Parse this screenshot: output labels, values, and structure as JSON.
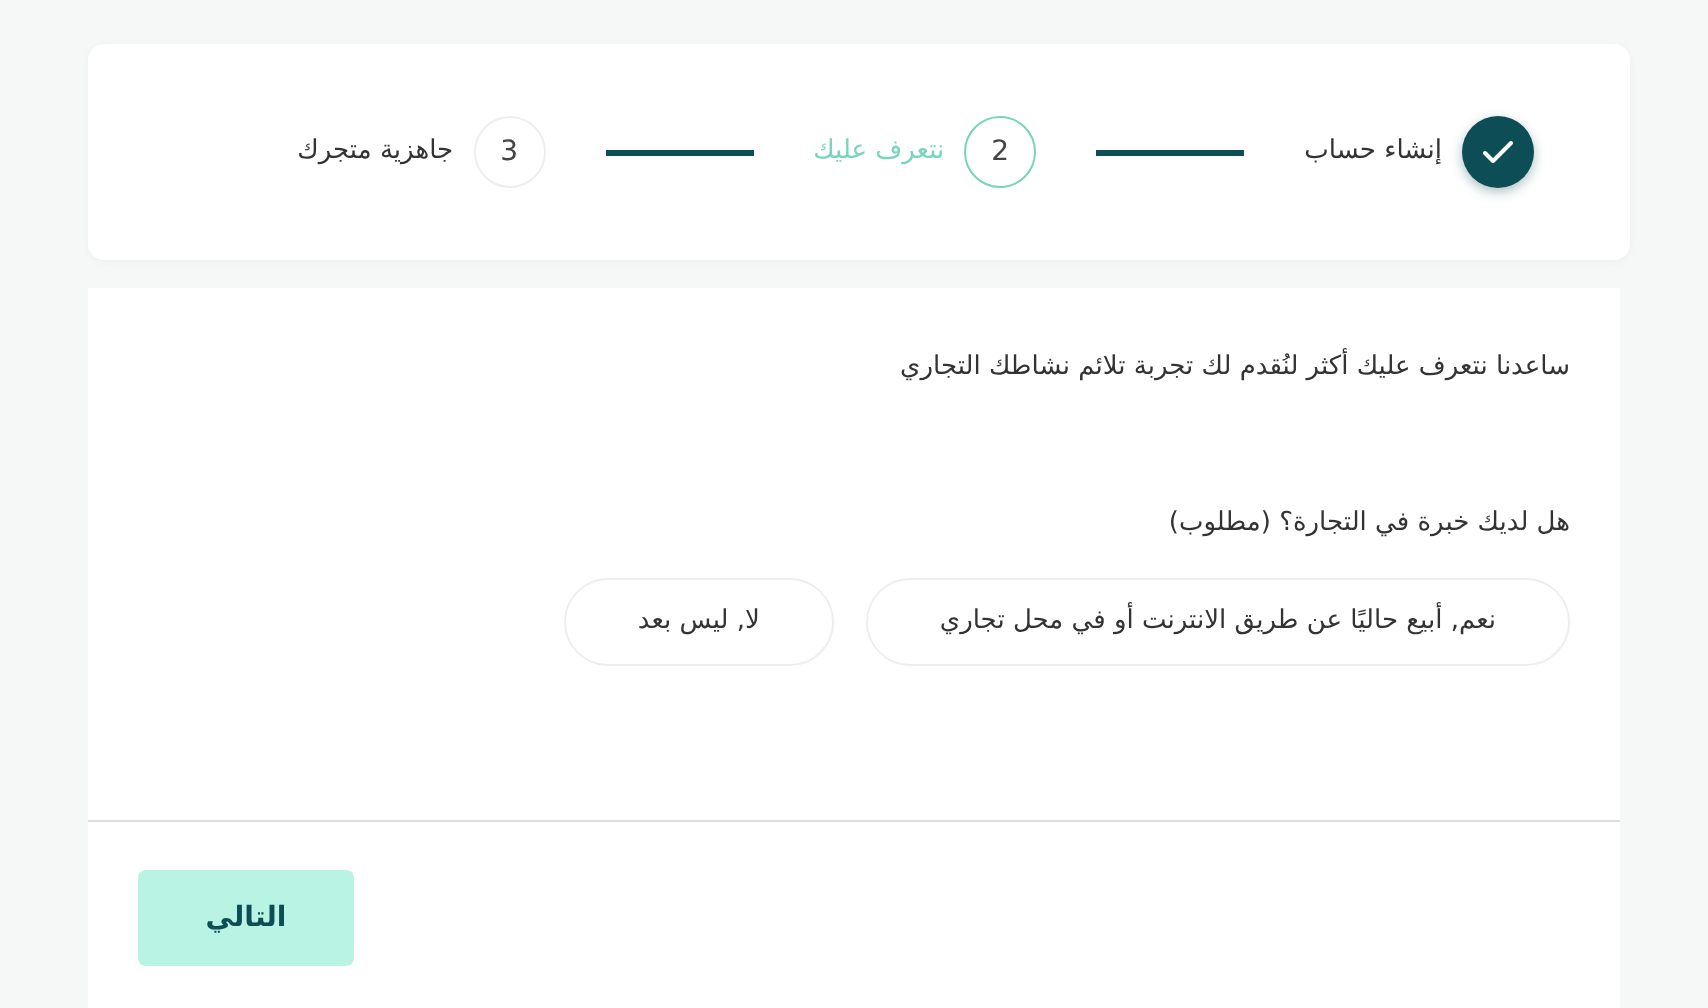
{
  "steps": [
    {
      "label": "إنشاء حساب",
      "done": true,
      "selected": false
    },
    {
      "number": "2",
      "label": "نتعرف عليك",
      "done": false,
      "selected": true
    },
    {
      "number": "3",
      "label": "جاهزية متجرك",
      "done": false,
      "selected": false
    }
  ],
  "intro": "ساعدنا نتعرف عليك أكثر لنُقدم لك تجربة تلائم نشاطك التجاري",
  "question": "هل لديك خبرة في التجارة؟ (مطلوب)",
  "options": [
    {
      "label": "نعم, أبيع حاليًا عن طريق الانترنت أو في محل تجاري"
    },
    {
      "label": "لا, ليس بعد"
    }
  ],
  "next_button": {
    "label": "التالي",
    "disabled": true
  }
}
